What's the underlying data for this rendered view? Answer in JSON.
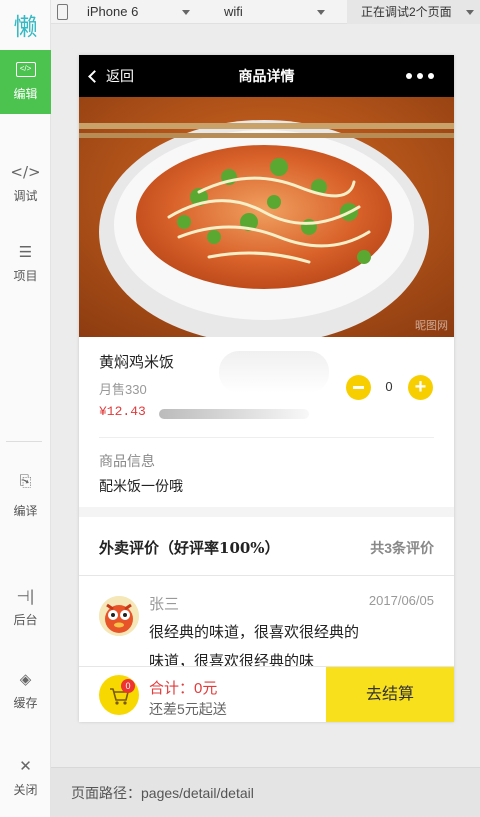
{
  "sidebar": {
    "logo": "懒",
    "items": [
      {
        "label": "编辑",
        "icon": "code-box-icon",
        "glyph": "</>"
      },
      {
        "label": "调试",
        "icon": "debug-code-icon",
        "glyph": "</>"
      },
      {
        "label": "项目",
        "icon": "menu-lines-icon",
        "glyph": "☰"
      },
      {
        "label": "编译",
        "icon": "compile-icon",
        "glyph": "⎘"
      },
      {
        "label": "后台",
        "icon": "backend-icon",
        "glyph": "⊣|"
      },
      {
        "label": "缓存",
        "icon": "layers-icon",
        "glyph": "◈"
      },
      {
        "label": "关闭",
        "icon": "close-icon",
        "glyph": "✕"
      }
    ]
  },
  "toolbar": {
    "device": "iPhone 6",
    "network": "wifi",
    "debug_pages": "正在调试2个页面"
  },
  "page": {
    "back_label": "返回",
    "title": "商品详情",
    "watermark": "昵图网",
    "product": {
      "name": "黄焖鸡米饭",
      "sales": "月售330",
      "price": "¥12.43",
      "quantity": "0",
      "info_label": "商品信息",
      "info_text": "配米饭一份哦"
    },
    "reviews": {
      "title": "外卖评价（好评率100%）",
      "count": "共3条评价",
      "items": [
        {
          "user": "张三",
          "date": "2017/06/05",
          "text": "很经典的味道，很喜欢很经典的味道，很喜欢很经典的味"
        }
      ]
    },
    "cart": {
      "badge": "0",
      "total": "合计：0元",
      "min_note": "还差5元起送",
      "checkout": "去结算"
    }
  },
  "path": "页面路径：pages/detail/detail",
  "colors": {
    "accent_green": "#4cc24f",
    "accent_yellow": "#f7d800",
    "price_red": "#e13b3b",
    "navbar": "#000000"
  }
}
